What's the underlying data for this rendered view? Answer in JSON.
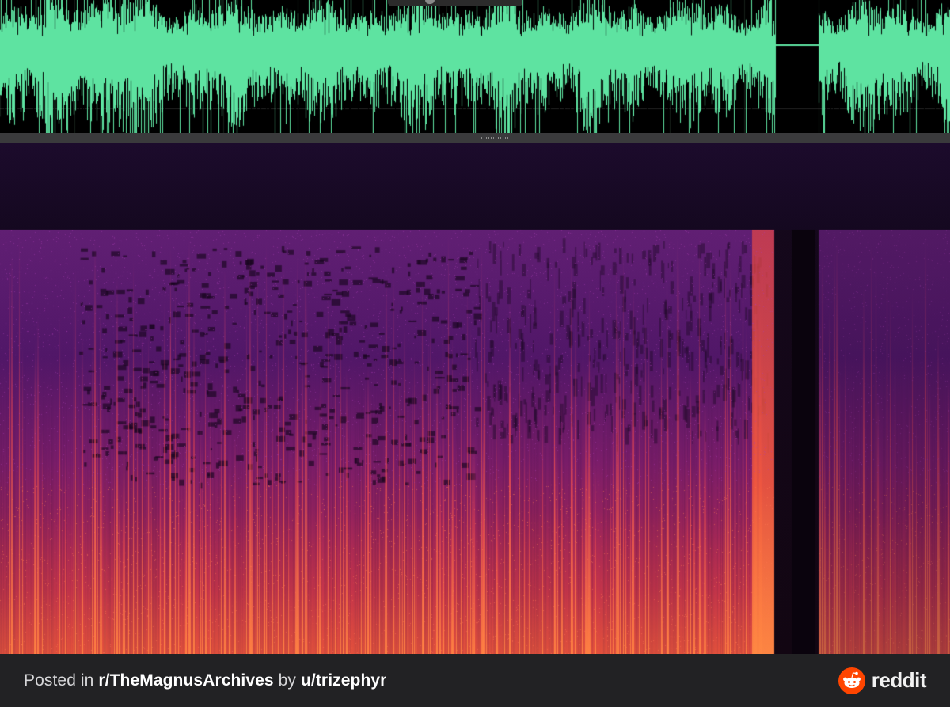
{
  "footer": {
    "posted_in": "Posted in",
    "subreddit": "r/TheMagnusArchives",
    "by": "by",
    "username": "u/trizephyr",
    "brand": "reddit"
  },
  "colors": {
    "waveform": "#5ee3a1",
    "background": "#000000",
    "divider": "#3a3a3c",
    "footer_bg": "#222224",
    "reddit_orange": "#ff4500"
  },
  "icons": [
    "reddit-logo-icon",
    "resize-grip-icon"
  ]
}
